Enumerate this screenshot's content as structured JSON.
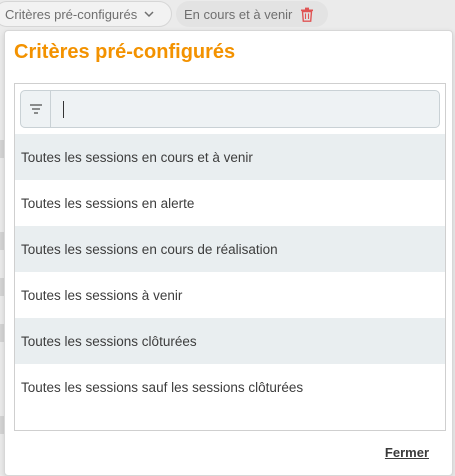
{
  "filters": {
    "criteria_chip_label": "Critères pré-configurés",
    "status_chip_label": "En cours et à venir",
    "trash_color": "#e05555"
  },
  "popup": {
    "title": "Critères pré-configurés",
    "title_color": "#f39200",
    "search": {
      "value": "",
      "placeholder": ""
    },
    "options": [
      "Toutes les sessions en cours et à venir",
      "Toutes les sessions en alerte",
      "Toutes les sessions en cours de réalisation",
      "Toutes les sessions à venir",
      "Toutes les sessions clôturées",
      "Toutes les sessions sauf les sessions clôturées"
    ],
    "close_label": "Fermer"
  }
}
